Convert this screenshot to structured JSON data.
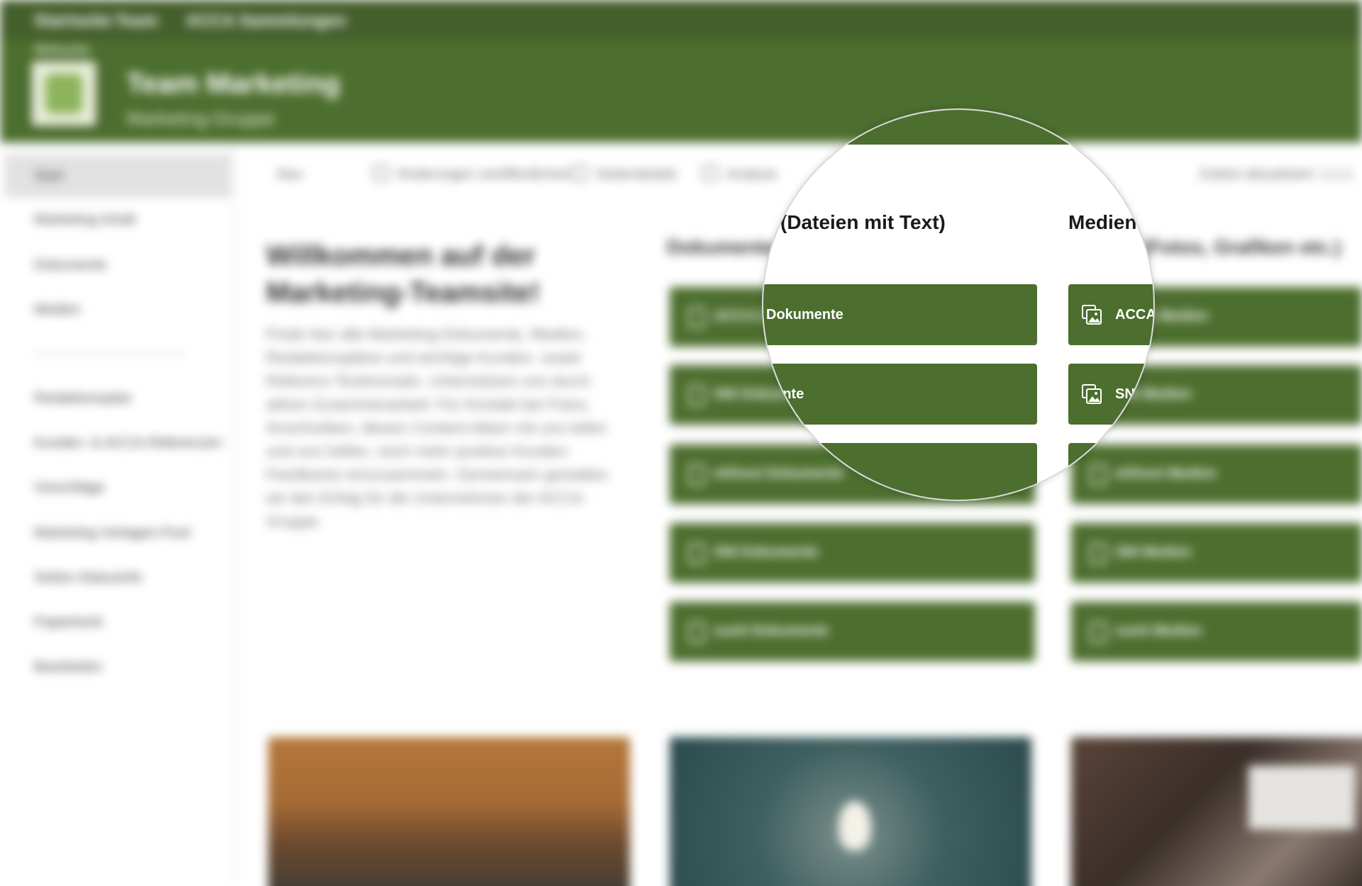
{
  "top_nav": {
    "links": [
      "Startseite",
      "Team",
      "ACCA Sammlungen"
    ]
  },
  "site": {
    "breadcrumb": "Webseite",
    "title": "Team Marketing",
    "subtitle": "Marketing-Gruppe"
  },
  "sidebar": {
    "items": [
      {
        "label": "Start"
      },
      {
        "label": "Marketing-Inhalt"
      },
      {
        "label": "Dokumente"
      },
      {
        "label": "Medien"
      },
      {
        "label": "Redaktionsplan"
      },
      {
        "label": "Kunden- & ACCA-Referenzen"
      },
      {
        "label": "Vorschläge"
      },
      {
        "label": "Marketing-Vorlagen-Pool"
      },
      {
        "label": "Seiten-Statusinfo"
      },
      {
        "label": "Papierkorb"
      },
      {
        "label": "Bearbeiten"
      }
    ]
  },
  "command_bar": {
    "new_label": "Neu",
    "details_label": "Änderungen veröffentlichen",
    "analytics_label": "Seitendetails",
    "share_label": "Analyse",
    "status_label": "Zuletzt aktualisiert: 1.1.1"
  },
  "welcome": {
    "title": "Willkommen auf der Marketing-Teamsite!",
    "text": "Finde hier alle Marketing-Dokumente, Medien, Redaktionspläne und wichtige Kunden- sowie Referenz-Testimonials. Unterstützen uns durch aktive Zusammenarbeit: Für Kontakt bei Fotos, Anschreiben, diesen Content-Ideen mit uns teilen und uns helfen, noch mehr positive Kunden-Feedbacks einzusammeln. Gemeinsam gestalten wir den Erfolg für die Unternehmen der ACCA-Gruppe."
  },
  "documents": {
    "heading": "Dokumente (Dateien mit Text)",
    "tiles": [
      "ACCA Dokumente",
      "SNI Dokumente",
      "eGhost Dokumente",
      "SNI Dokumente",
      "sunit Dokumente"
    ]
  },
  "media": {
    "heading": "Medien (Fotos, Grafiken etc.)",
    "tiles": [
      "ACCA Medien",
      "SNI Medien",
      "eGhost Medien",
      "SNI Medien",
      "sunit Medien"
    ]
  },
  "magnifier": {
    "doc_heading": "(Dateien mit Text)",
    "media_heading": "Medien",
    "doc_tile_1": "Dokumente",
    "doc_tile_2": "nente",
    "media_tile_1": "ACCA",
    "media_tile_2": "SN"
  },
  "colors": {
    "brand_green": "#4c6e2e",
    "topbar_green": "#445f2c",
    "accent_light": "#dfe8d2"
  }
}
